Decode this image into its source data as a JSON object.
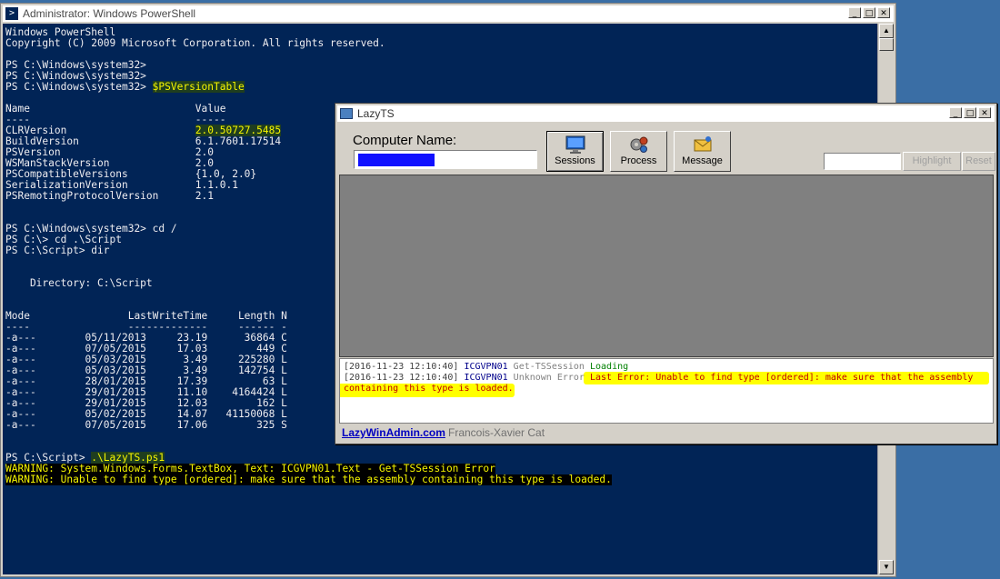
{
  "powershell": {
    "title": "Administrator: Windows PowerShell",
    "lines": {
      "l1": "Windows PowerShell",
      "l2": "Copyright (C) 2009 Microsoft Corporation. All rights reserved.",
      "l3": "PS C:\\Windows\\system32>",
      "l4": "PS C:\\Windows\\system32>",
      "l5_prompt": "PS C:\\Windows\\system32> ",
      "l5_cmd": "$PSVersionTable",
      "hdr": "Name                           Value",
      "hdr_u": "----                           -----",
      "clr_name": "CLRVersion                     ",
      "clr_val": "2.0.50727.5485",
      "build": "BuildVersion                   6.1.7601.17514",
      "psv": "PSVersion                      2.0",
      "wsman": "WSManStackVersion              2.0",
      "pscompat": "PSCompatibleVersions           {1.0, 2.0}",
      "serial": "SerializationVersion           1.1.0.1",
      "psremote": "PSRemotingProtocolVersion      2.1",
      "cd1": "PS C:\\Windows\\system32> cd /",
      "cd2": "PS C:\\> cd .\\Script",
      "dir": "PS C:\\Script> dir",
      "directory": "    Directory: C:\\Script",
      "cols": "Mode                LastWriteTime     Length N",
      "cols_u": "----                -------------     ------ -",
      "final_prompt": "PS C:\\Script> ",
      "final_cmd": ".\\LazyTS.ps1",
      "warn1": "WARNING: System.Windows.Forms.TextBox, Text: ICGVPN01.Text - Get-TSSession Error",
      "warn2": "WARNING: Unable to find type [ordered]: make sure that the assembly containing this type is loaded."
    },
    "files": [
      {
        "row": "-a---        05/11/2013     23.19      36864 C"
      },
      {
        "row": "-a---        07/05/2015     17.03        449 C"
      },
      {
        "row": "-a---        05/03/2015      3.49     225280 L"
      },
      {
        "row": "-a---        05/03/2015      3.49     142754 L"
      },
      {
        "row": "-a---        28/01/2015     17.39         63 L"
      },
      {
        "row": "-a---        29/01/2015     11.10    4164424 L"
      },
      {
        "row": "-a---        29/01/2015     12.03        162 L"
      },
      {
        "row": "-a---        05/02/2015     14.07   41150068 L"
      },
      {
        "row": "-a---        07/05/2015     17.06        325 S"
      }
    ]
  },
  "lazyts": {
    "title": "LazyTS",
    "computer_label": "Computer Name:",
    "buttons": {
      "sessions": "Sessions",
      "process": "Process",
      "message": "Message",
      "highlight": "Highlight",
      "reset": "Reset"
    },
    "log": {
      "line1": {
        "ts": "[2016-11-23 12:10:40]",
        "computer": "ICGVPN01",
        "cmd": "Get-TSSession",
        "status": "Loading"
      },
      "line2": {
        "ts": "[2016-11-23 12:10:40]",
        "computer": "ICGVPN01",
        "cmd": "Unknown Error",
        "msg1": "Last Error: Unable to find type [ordered]: make sure that the assembly",
        "msg2": "containing this type is loaded."
      }
    },
    "status": {
      "link": "LazyWinAdmin.com",
      "author": "Francois-Xavier Cat"
    }
  },
  "colors": {
    "console_bg": "#012456",
    "console_fg": "#eeedf0",
    "highlight": "#f6f600",
    "desktop": "#3a6ea5"
  }
}
